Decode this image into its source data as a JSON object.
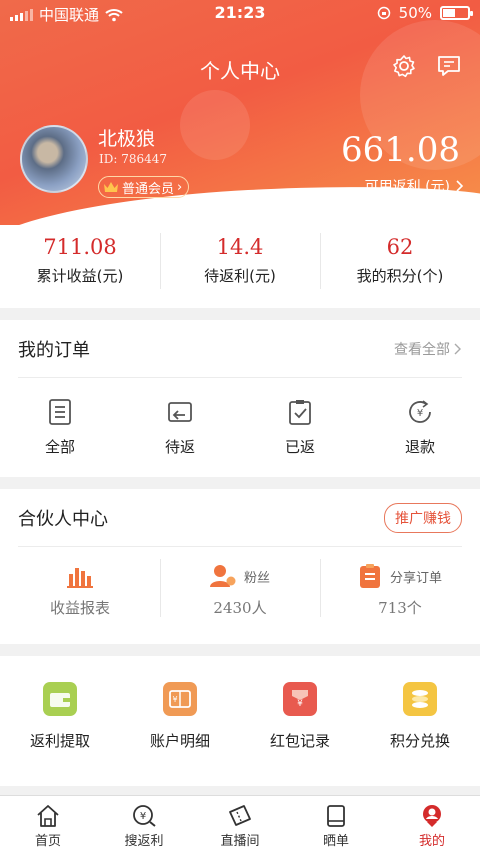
{
  "status_bar": {
    "carrier": "中国联通",
    "time": "21:23",
    "battery": "50%"
  },
  "header": {
    "title": "个人中心"
  },
  "profile": {
    "name": "北极狼",
    "id": "ID: 786447",
    "level": "普通会员",
    "balance": "661.08",
    "balance_label": "可用返利 (元)"
  },
  "stats": [
    {
      "value": "711.08",
      "label": "累计收益(元)"
    },
    {
      "value": "14.4",
      "label": "待返利(元)"
    },
    {
      "value": "62",
      "label": "我的积分(个)"
    }
  ],
  "orders": {
    "title": "我的订单",
    "see_all": "查看全部",
    "items": [
      {
        "label": "全部",
        "icon": "clipboard-list-icon"
      },
      {
        "label": "待返",
        "icon": "return-arrow-icon"
      },
      {
        "label": "已返",
        "icon": "clipboard-check-icon"
      },
      {
        "label": "退款",
        "icon": "yen-refund-icon"
      }
    ]
  },
  "partner": {
    "title": "合伙人中心",
    "promo": "推广赚钱",
    "items": [
      {
        "label": "收益报表",
        "icon": "bar-chart-icon"
      },
      {
        "title": "粉丝",
        "value": "2430人",
        "icon": "fans-icon"
      },
      {
        "title": "分享订单",
        "value": "713个",
        "icon": "share-order-icon"
      }
    ]
  },
  "tools": [
    {
      "label": "返利提取",
      "icon": "wallet-icon",
      "color": "#a9cf52"
    },
    {
      "label": "账户明细",
      "icon": "ledger-icon",
      "color": "#f09a55"
    },
    {
      "label": "红包记录",
      "icon": "red-envelope-icon",
      "color": "#e85a4f"
    },
    {
      "label": "积分兑换",
      "icon": "coins-icon",
      "color": "#f4c542"
    }
  ],
  "tabs": [
    {
      "label": "首页",
      "icon": "home-icon"
    },
    {
      "label": "搜返利",
      "icon": "yen-search-icon"
    },
    {
      "label": "直播间",
      "icon": "ticket-icon"
    },
    {
      "label": "晒单",
      "icon": "book-icon"
    },
    {
      "label": "我的",
      "icon": "profile-icon",
      "active": true
    }
  ],
  "colors": {
    "accent": "#d42b2b",
    "header_start": "#f06a4a",
    "header_end": "#f7924a"
  }
}
